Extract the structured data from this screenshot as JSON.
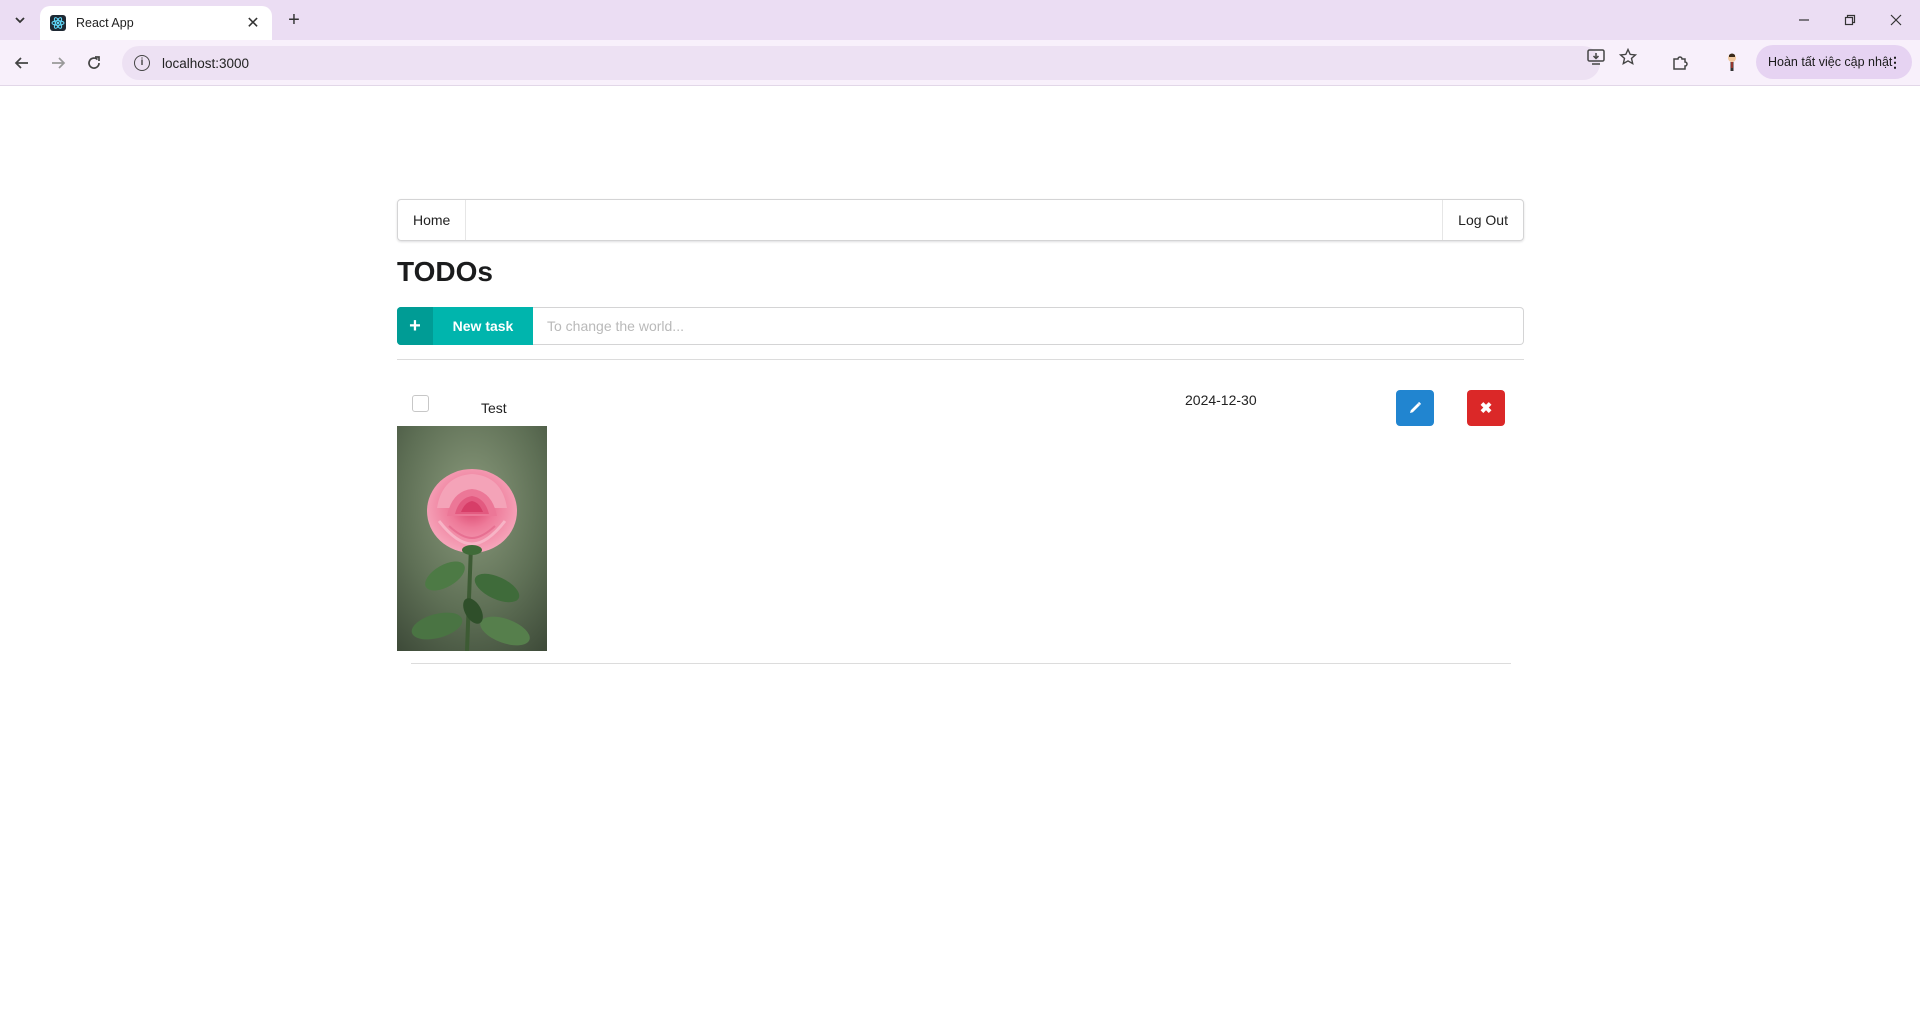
{
  "browser": {
    "tab_title": "React App",
    "url": "localhost:3000",
    "update_label": "Hoàn tất việc cập nhật"
  },
  "nav": {
    "home": "Home",
    "logout": "Log Out"
  },
  "page": {
    "title": "TODOs",
    "new_task_label": "New task",
    "input_placeholder": "To change the world..."
  },
  "tasks": [
    {
      "name": "Test",
      "date": "2024-12-30",
      "completed": false,
      "image": "pink-rose-photo"
    }
  ],
  "colors": {
    "primary_teal": "#00b5ad",
    "edit_blue": "#2185d0",
    "delete_red": "#db2828"
  }
}
